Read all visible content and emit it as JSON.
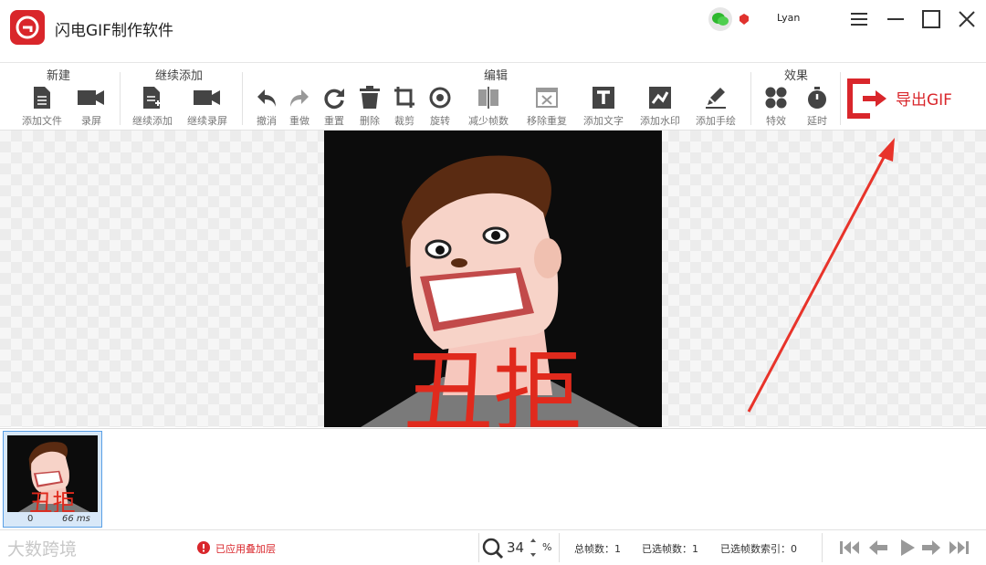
{
  "app": {
    "title": "闪电GIF制作软件",
    "user": "Lyan"
  },
  "toolbar": {
    "groups": [
      {
        "title": "新建"
      },
      {
        "title": "继续添加"
      },
      {
        "title": "编辑"
      },
      {
        "title": "效果"
      }
    ],
    "tools": [
      {
        "label": "添加文件",
        "icon": "file-icon"
      },
      {
        "label": "录屏",
        "icon": "camera-icon"
      },
      {
        "label": "继续添加",
        "icon": "add-file-icon"
      },
      {
        "label": "继续录屏",
        "icon": "camera-icon"
      },
      {
        "label": "撤消",
        "icon": "undo-icon"
      },
      {
        "label": "重做",
        "icon": "redo-icon"
      },
      {
        "label": "重置",
        "icon": "reset-icon"
      },
      {
        "label": "删除",
        "icon": "trash-icon"
      },
      {
        "label": "裁剪",
        "icon": "crop-icon"
      },
      {
        "label": "旋转",
        "icon": "rotate-icon"
      },
      {
        "label": "减少帧数",
        "icon": "reduce-frames-icon"
      },
      {
        "label": "移除重复",
        "icon": "remove-duplicate-icon"
      },
      {
        "label": "添加文字",
        "icon": "text-icon"
      },
      {
        "label": "添加水印",
        "icon": "watermark-icon"
      },
      {
        "label": "添加手绘",
        "icon": "brush-icon"
      },
      {
        "label": "特效",
        "icon": "effects-icon"
      },
      {
        "label": "延时",
        "icon": "timer-icon"
      }
    ],
    "export_label": "导出GIF"
  },
  "canvas": {
    "overlay_text": "丑拒"
  },
  "filmstrip": {
    "frames": [
      {
        "index": "0",
        "duration": "66 ms",
        "overlay_text": "丑拒"
      }
    ]
  },
  "status": {
    "applied_label": "已应用叠加层",
    "zoom": "34",
    "zoom_unit": "%",
    "total_frames": "总帧数：1",
    "selected_frames": "已选帧数：1",
    "selected_index": "已选帧数索引：0"
  },
  "watermark": "大数跨境",
  "colors": {
    "accent": "#d9262b"
  }
}
